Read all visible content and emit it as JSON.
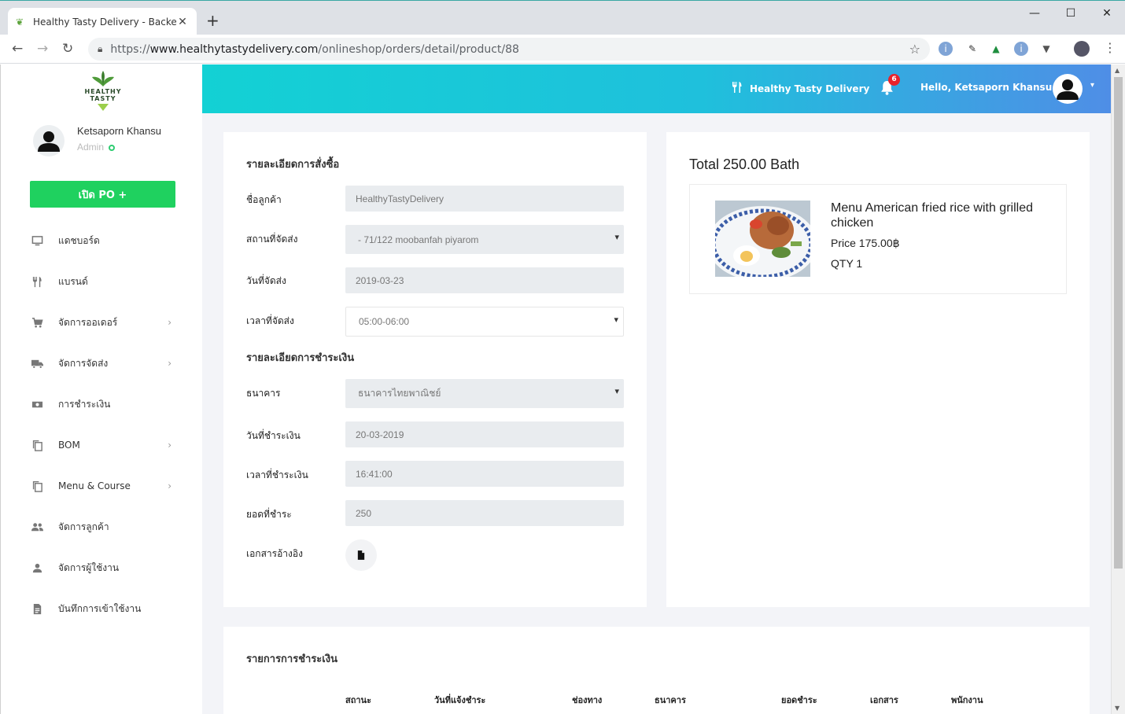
{
  "browser": {
    "tab_title": "Healthy Tasty Delivery - Backend",
    "url_scheme": "https://",
    "url_host": "www.healthytastydelivery.com",
    "url_path": "/onlineshop/orders/detail/product/88"
  },
  "sidebar": {
    "logo_line1": "HEALTHY",
    "logo_line2": "TASTY",
    "user_name": "Ketsaporn Khansu",
    "user_role": "Admin",
    "po_button": "เปิด PO  +",
    "items": [
      {
        "label": "แดชบอร์ด",
        "icon": "monitor-icon",
        "chevron": false
      },
      {
        "label": "แบรนด์",
        "icon": "fork-knife-icon",
        "chevron": false
      },
      {
        "label": "จัดการออเดอร์",
        "icon": "cart-icon",
        "chevron": true
      },
      {
        "label": "จัดการจัดส่ง",
        "icon": "truck-icon",
        "chevron": true
      },
      {
        "label": "การชำระเงิน",
        "icon": "money-icon",
        "chevron": false
      },
      {
        "label": "BOM",
        "icon": "copy-icon",
        "chevron": true
      },
      {
        "label": "Menu & Course",
        "icon": "copy-icon",
        "chevron": true
      },
      {
        "label": "จัดการลูกค้า",
        "icon": "people-icon",
        "chevron": false
      },
      {
        "label": "จัดการผู้ใช้งาน",
        "icon": "person-icon",
        "chevron": false
      },
      {
        "label": "บันทึกการเข้าใช้งาน",
        "icon": "document-icon",
        "chevron": false
      }
    ]
  },
  "header": {
    "brand": "Healthy Tasty Delivery",
    "notification_count": "6",
    "greeting": "Hello, Ketsaporn Khansu !"
  },
  "order": {
    "section_title": "รายละเอียดการสั่งซื้อ",
    "customer_label": "ชื่อลูกค้า",
    "customer_value": "HealthyTastyDelivery",
    "location_label": "สถานที่จัดส่ง",
    "location_value": "- 71/122 moobanfah piyarom",
    "date_label": "วันที่จัดส่ง",
    "date_value": "2019-03-23",
    "time_label": "เวลาที่จัดส่ง",
    "time_value": "05:00-06:00"
  },
  "payment": {
    "section_title": "รายละเอียดการชำระเงิน",
    "bank_label": "ธนาคาร",
    "bank_value": "ธนาคารไทยพาณิชย์",
    "pay_date_label": "วันที่ชำระเงิน",
    "pay_date_value": "20-03-2019",
    "pay_time_label": "เวลาที่ชำระเงิน",
    "pay_time_value": "16:41:00",
    "amount_label": "ยอดที่ชำระ",
    "amount_value": "250",
    "doc_label": "เอกสารอ้างอิง"
  },
  "summary": {
    "total": "Total 250.00 Bath",
    "product_name": "Menu American fried rice with grilled chicken",
    "product_price": "Price 175.00฿",
    "product_qty": "QTY 1"
  },
  "payments_table": {
    "title": "รายการการชำระเงิน",
    "columns": [
      "สถานะ",
      "วันที่แจ้งชำระ",
      "ช่องทาง",
      "ธนาคาร",
      "ยอดชำระ",
      "เอกสาร",
      "พนักงาน"
    ]
  }
}
